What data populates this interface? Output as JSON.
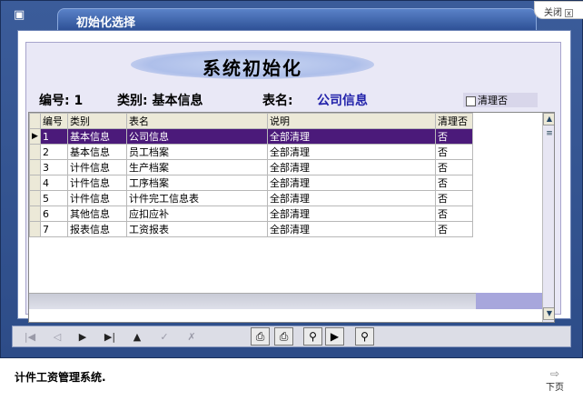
{
  "window": {
    "title": "初始化选择",
    "close_label": "关闭",
    "close_glyph": "x"
  },
  "banner": {
    "title": "系统初始化"
  },
  "info": {
    "number_label": "编号:",
    "number_value": "1",
    "category_label": "类别:",
    "category_value": "基本信息",
    "table_label": "表名:",
    "table_value": "公司信息",
    "clear_checkbox_label": "清理否",
    "clear_checked": false
  },
  "grid": {
    "headers": [
      "编号",
      "类别",
      "表名",
      "说明",
      "清理否"
    ],
    "selected_index": 0,
    "rows": [
      [
        "1",
        "基本信息",
        "公司信息",
        "全部清理",
        "否"
      ],
      [
        "2",
        "基本信息",
        "员工档案",
        "全部清理",
        "否"
      ],
      [
        "3",
        "计件信息",
        "生产档案",
        "全部清理",
        "否"
      ],
      [
        "4",
        "计件信息",
        "工序档案",
        "全部清理",
        "否"
      ],
      [
        "5",
        "计件信息",
        "计件完工信息表",
        "全部清理",
        "否"
      ],
      [
        "6",
        "其他信息",
        "应扣应补",
        "全部清理",
        "否"
      ],
      [
        "7",
        "报表信息",
        "工资报表",
        "全部清理",
        "否"
      ]
    ]
  },
  "status": {
    "text": "计件工资管理系统.",
    "next_label": "下页"
  },
  "colors": {
    "selected_row": "#4b1a7a",
    "title_bar": "#2d4c88"
  }
}
